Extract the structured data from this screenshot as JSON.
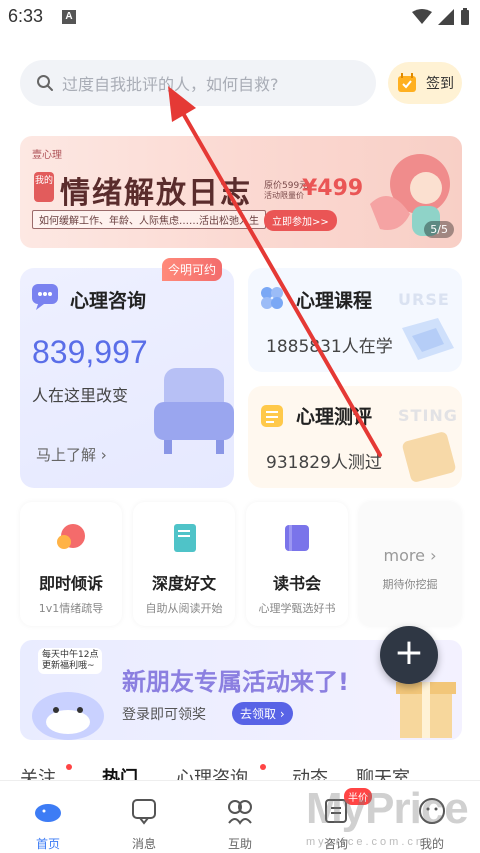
{
  "status": {
    "time": "6:33",
    "notif_letter": "A"
  },
  "search": {
    "placeholder": "过度自我批评的人，如何自救?"
  },
  "checkin": {
    "label": "签到"
  },
  "banner": {
    "brand": "壹心理",
    "tag": "我的",
    "title": "情绪解放日志",
    "subtitle": "如何缓解工作、年龄、人际焦虑……活出松弛人生",
    "price_orig": "原价599元",
    "price_note": "活动限量价",
    "price": "¥499",
    "join": "立即参加>>",
    "page": "5/5"
  },
  "consult": {
    "tag": "今明可约",
    "title": "心理咨询",
    "count": "839,997",
    "sub": "人在这里改变",
    "link": "马上了解 ›"
  },
  "course": {
    "title": "心理课程",
    "watermark": "URSE",
    "sub": "1885831人在学"
  },
  "test": {
    "title": "心理测评",
    "watermark": "STING",
    "sub": "931829人测过"
  },
  "tiles": [
    {
      "title": "即时倾诉",
      "sub": "1v1情绪疏导"
    },
    {
      "title": "深度好文",
      "sub": "自助从阅读开始"
    },
    {
      "title": "读书会",
      "sub": "心理学甄选好书"
    }
  ],
  "more": {
    "label": "more ›",
    "sub": "期待你挖掘"
  },
  "fab": {
    "label": "+"
  },
  "promo": {
    "bubble_line1": "每天中午12点",
    "bubble_line2": "更新福利哦~",
    "title": "新朋友专属活动来了!",
    "sub": "登录即可领奖",
    "button": "去领取 ›"
  },
  "content_tabs": [
    "关注",
    "热门",
    "心理咨询",
    "动态",
    "聊天室"
  ],
  "bottom_nav": [
    {
      "label": "首页"
    },
    {
      "label": "消息"
    },
    {
      "label": "互助"
    },
    {
      "label": "咨询"
    },
    {
      "label": "我的"
    }
  ],
  "badge_half": "半价",
  "watermark": {
    "brand": "MyPrice",
    "url": "myprice.com.cn"
  },
  "colors": {
    "accent": "#3d7cf5",
    "annotation_arrow": "#e53935"
  }
}
